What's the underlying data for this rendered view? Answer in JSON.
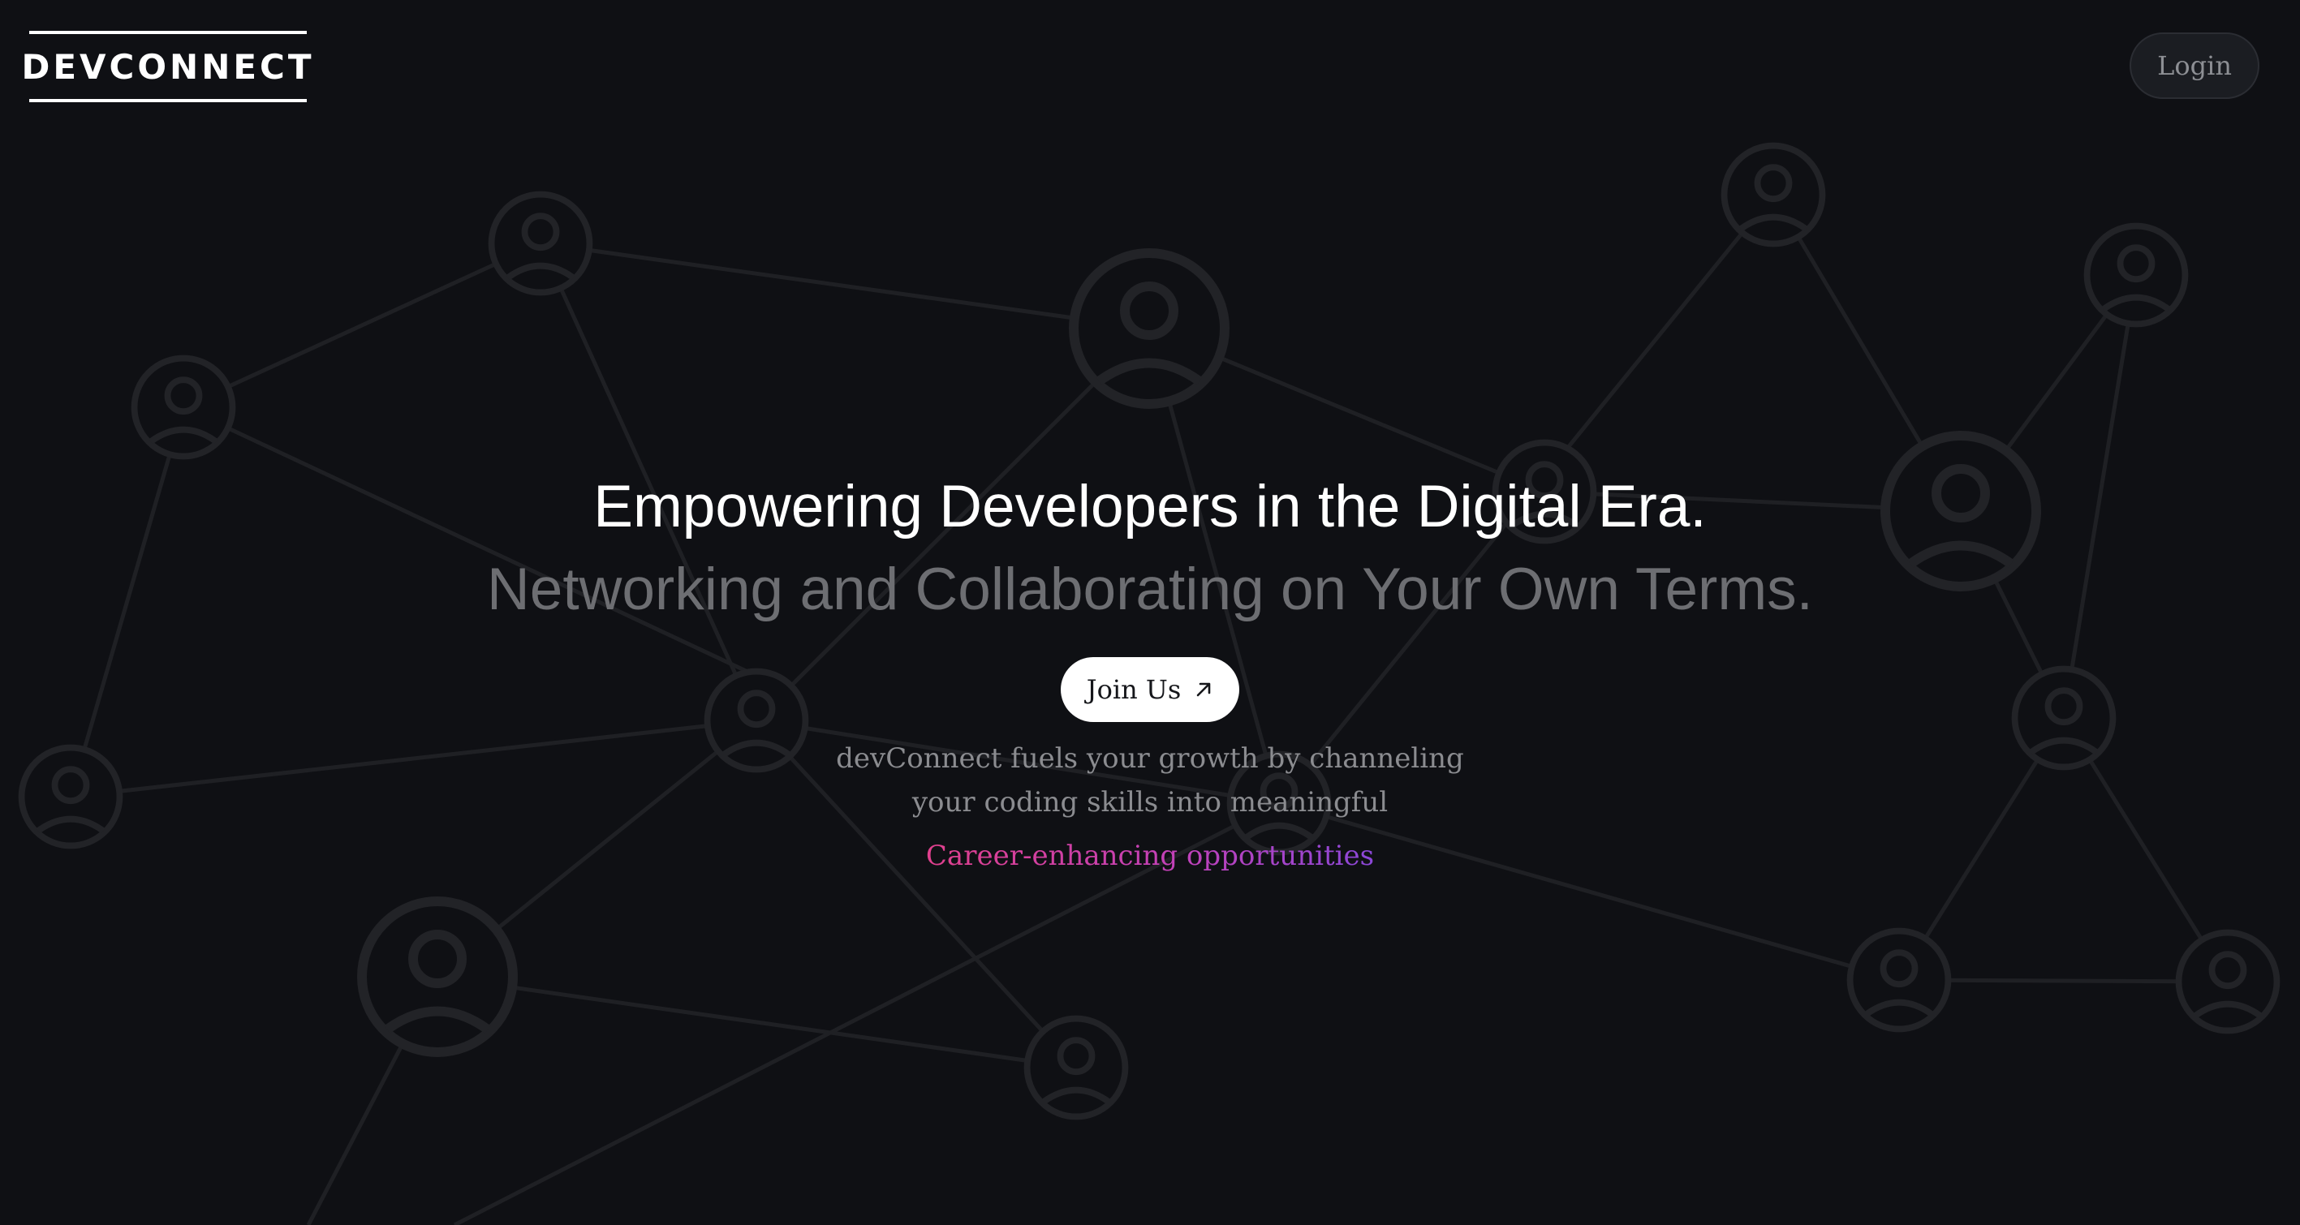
{
  "header": {
    "logo_text": "DEVCONNECT",
    "login_label": "Login"
  },
  "hero": {
    "title": "Empowering Developers in the Digital Era.",
    "subtitle": "Networking and Collaborating on Your Own Terms.",
    "cta_label": "Join Us",
    "cta_icon": "arrow-up-right-icon",
    "description_line1": "devConnect fuels your growth by channeling",
    "description_line2": "your coding skills into meaningful",
    "highlight": "Career-enhancing opportunities"
  },
  "background": {
    "icon": "user-avatar-icon",
    "line_color": "#1f2024",
    "node_color": "#222327"
  },
  "colors": {
    "background": "#0f1014",
    "text_primary": "#ffffff",
    "text_muted": "#6d6e72",
    "gradient_start": "#e0408d",
    "gradient_end": "#8b47d8"
  }
}
